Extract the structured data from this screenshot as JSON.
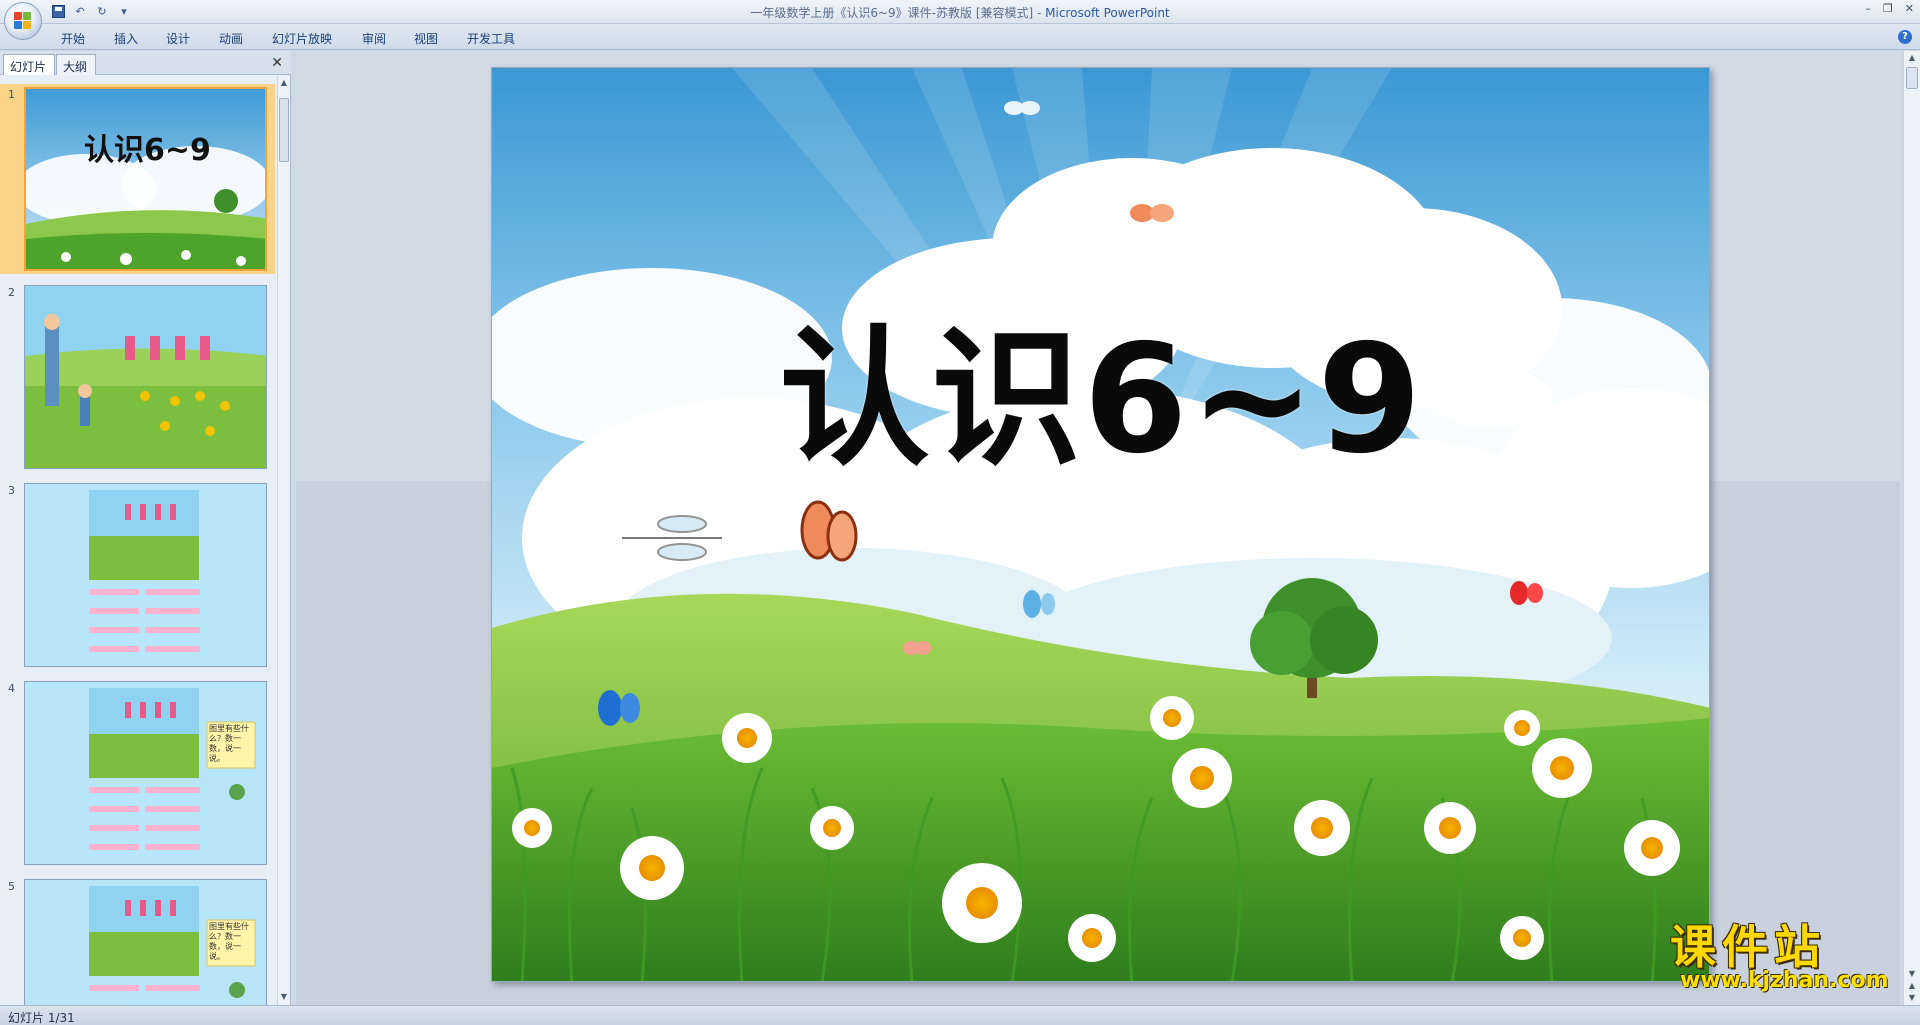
{
  "window": {
    "title": "一年级数学上册《认识6~9》课件-苏教版 [兼容模式] - ",
    "app_name": "Microsoft PowerPoint"
  },
  "ribbon": {
    "tabs": [
      "开始",
      "插入",
      "设计",
      "动画",
      "幻灯片放映",
      "审阅",
      "视图",
      "开发工具"
    ]
  },
  "left_pane": {
    "tabs": [
      "幻灯片",
      "大纲"
    ],
    "slides": [
      {
        "number": "1",
        "title": "认识6~9",
        "selected": true
      },
      {
        "number": "2",
        "selected": false
      },
      {
        "number": "3",
        "selected": false
      },
      {
        "number": "4",
        "callout": "图里有些什么？数一数，说一说。",
        "selected": false
      },
      {
        "number": "5",
        "callout": "图里有些什么？数一数，说一说。",
        "selected": false
      }
    ]
  },
  "slide": {
    "title": "认识6~9"
  },
  "status_bar": {
    "text": "幻灯片 1/31"
  },
  "watermark": {
    "name": "课件站",
    "url": "www.kjzhan.com"
  },
  "colors": {
    "sky_top": "#4aa6d8",
    "grass": "#6bbf3a",
    "selection": "#f2a33a",
    "ribbon": "#dbe4ef"
  }
}
